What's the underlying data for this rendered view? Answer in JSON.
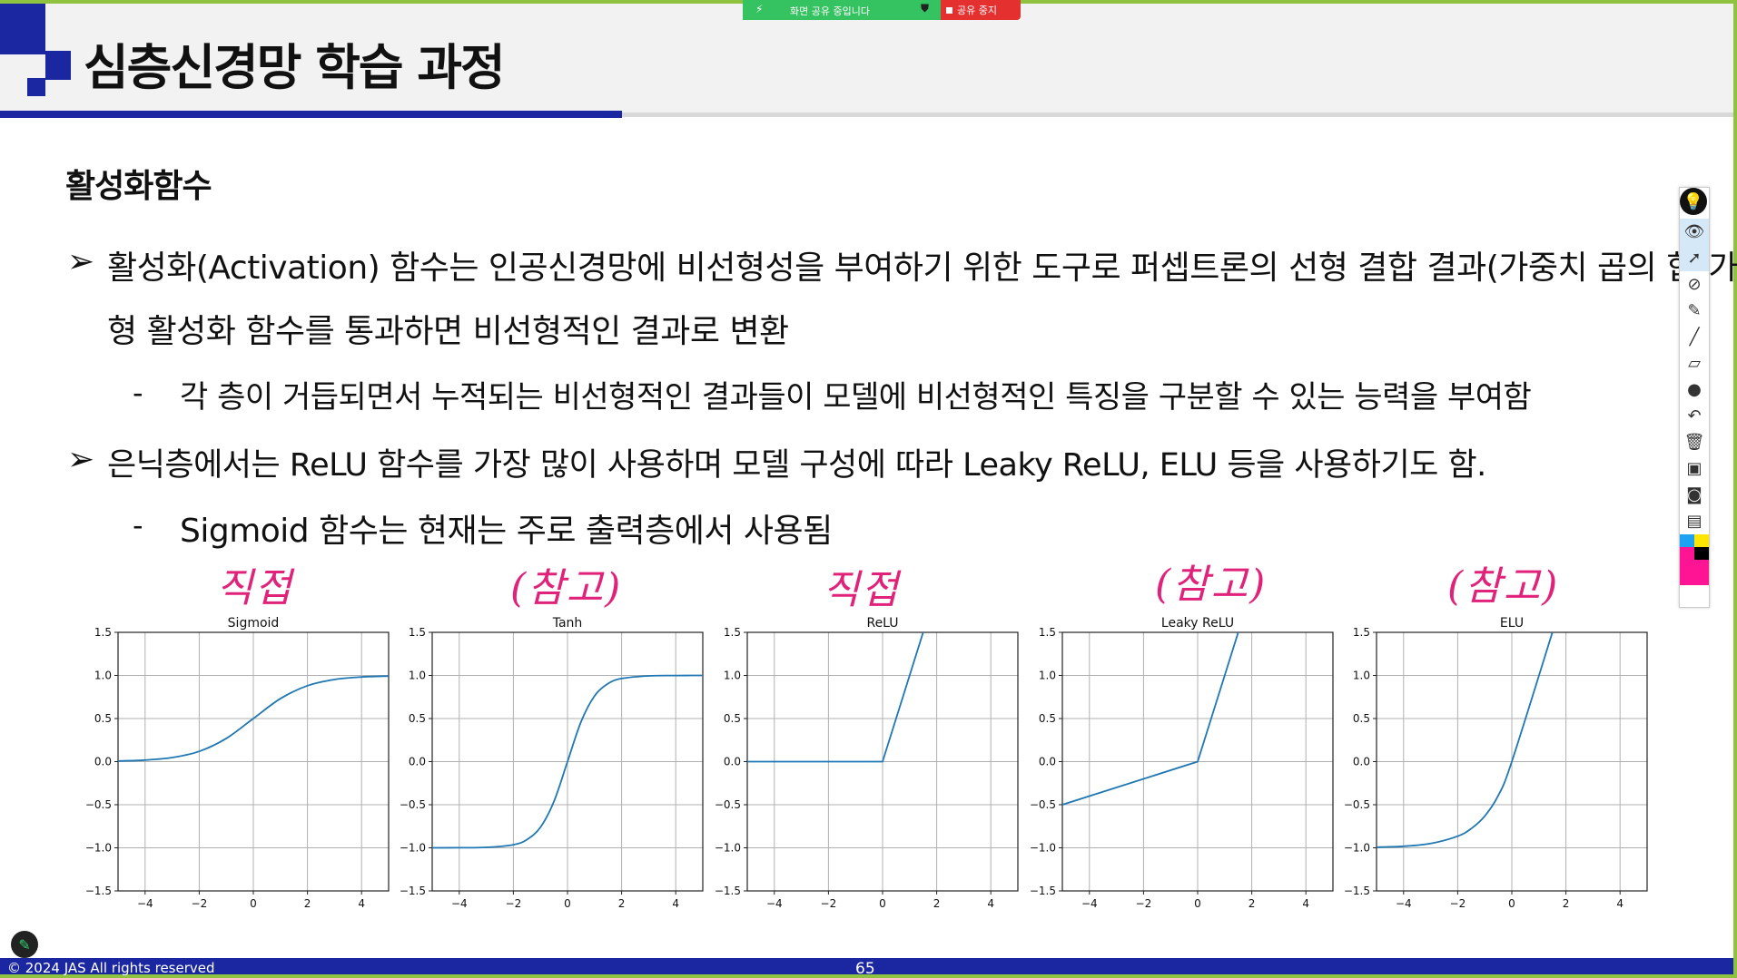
{
  "share_banner": {
    "sharing_text": "화면 공유 중입니다",
    "stop_label": "공유 중지",
    "colors": {
      "sharing": "#35c260",
      "stop": "#e53030"
    }
  },
  "slide": {
    "title": "심층신경망 학습 과정",
    "section_heading": "활성화함수",
    "bullets": [
      {
        "line1": "활성화(Activation) 함수는 인공신경망에 비선형성을 부여하기 위한 도구로 퍼셉트론의 선형 결합 결과(가중치 곱의 합)가 비선",
        "line2": "형 활성화 함수를 통과하면 비선형적인 결과로 변환",
        "sub": "각 층이 거듭되면서 누적되는 비선형적인 결과들이 모델에 비선형적인 특징을 구분할 수 있는 능력을 부여함"
      },
      {
        "line1": "은닉층에서는 ReLU 함수를 가장 많이 사용하며 모델 구성에 따라 Leaky ReLU, ELU 등을 사용하기도 함.",
        "sub": "Sigmoid 함수는 현재는 주로 출력층에서 사용됨"
      }
    ],
    "arrow_glyph": "➢",
    "dash_glyph": "-",
    "annotations": [
      "직접",
      "(참고)",
      "직접",
      "(참고)",
      "(참고)"
    ],
    "annotation_color": "#e0227a",
    "footer": {
      "copyright": "© 2024 JAS All rights reserved",
      "page_number": "65"
    },
    "brand_color": "#1a27a0"
  },
  "chart_data": [
    {
      "type": "line",
      "title": "Sigmoid",
      "xlim": [
        -5,
        5
      ],
      "ylim": [
        -1.5,
        1.5
      ],
      "xticks": [
        "−4",
        "−2",
        "0",
        "2",
        "4"
      ],
      "yticks": [
        "1.5",
        "1.0",
        "0.5",
        "0.0",
        "−0.5",
        "−1.0",
        "−1.5"
      ],
      "grid": true,
      "x": [
        -5,
        -4,
        -3,
        -2,
        -1,
        0,
        1,
        2,
        3,
        4,
        5
      ],
      "y": [
        0.007,
        0.018,
        0.047,
        0.119,
        0.269,
        0.5,
        0.731,
        0.881,
        0.953,
        0.982,
        0.993
      ]
    },
    {
      "type": "line",
      "title": "Tanh",
      "xlim": [
        -5,
        5
      ],
      "ylim": [
        -1.5,
        1.5
      ],
      "xticks": [
        "−4",
        "−2",
        "0",
        "2",
        "4"
      ],
      "yticks": [
        "1.5",
        "1.0",
        "0.5",
        "0.0",
        "−0.5",
        "−1.0",
        "−1.5"
      ],
      "grid": true,
      "x": [
        -5,
        -4,
        -3,
        -2,
        -1.5,
        -1,
        -0.5,
        0,
        0.5,
        1,
        1.5,
        2,
        3,
        4,
        5
      ],
      "y": [
        -1.0,
        -0.999,
        -0.995,
        -0.964,
        -0.905,
        -0.762,
        -0.462,
        0,
        0.462,
        0.762,
        0.905,
        0.964,
        0.995,
        0.999,
        1.0
      ]
    },
    {
      "type": "line",
      "title": "ReLU",
      "xlim": [
        -5,
        5
      ],
      "ylim": [
        -1.5,
        1.5
      ],
      "xticks": [
        "−4",
        "−2",
        "0",
        "2",
        "4"
      ],
      "yticks": [
        "1.5",
        "1.0",
        "0.5",
        "0.0",
        "−0.5",
        "−1.0",
        "−1.5"
      ],
      "grid": true,
      "x": [
        -5,
        0,
        1.5
      ],
      "y": [
        0,
        0,
        1.5
      ]
    },
    {
      "type": "line",
      "title": "Leaky ReLU",
      "xlim": [
        -5,
        5
      ],
      "ylim": [
        -1.5,
        1.5
      ],
      "xticks": [
        "−4",
        "−2",
        "0",
        "2",
        "4"
      ],
      "yticks": [
        "1.5",
        "1.0",
        "0.5",
        "0.0",
        "−0.5",
        "−1.0",
        "−1.5"
      ],
      "grid": true,
      "x": [
        -5,
        0,
        1.5
      ],
      "y": [
        -0.5,
        0,
        1.5
      ]
    },
    {
      "type": "line",
      "title": "ELU",
      "xlim": [
        -5,
        5
      ],
      "ylim": [
        -1.5,
        1.5
      ],
      "xticks": [
        "−4",
        "−2",
        "0",
        "2",
        "4"
      ],
      "yticks": [
        "1.5",
        "1.0",
        "0.5",
        "0.0",
        "−0.5",
        "−1.0",
        "−1.5"
      ],
      "grid": true,
      "x": [
        -5,
        -4,
        -3,
        -2,
        -1.5,
        -1,
        -0.5,
        0,
        1.5
      ],
      "y": [
        -0.993,
        -0.982,
        -0.95,
        -0.865,
        -0.777,
        -0.632,
        -0.393,
        0,
        1.5
      ]
    }
  ],
  "toolbar": {
    "tools": [
      "lamp-icon",
      "eye-icon",
      "pointer-icon",
      "laser-icon",
      "highlighter-icon",
      "pen-icon",
      "eraser-icon",
      "dot-icon",
      "undo-icon",
      "trash-icon",
      "screen-icon",
      "camera-icon",
      "clipboard-icon",
      "color-swatch"
    ],
    "swatch_colors": [
      "#1da1f2",
      "#ffe600",
      "#ff1493",
      "#000000"
    ]
  }
}
